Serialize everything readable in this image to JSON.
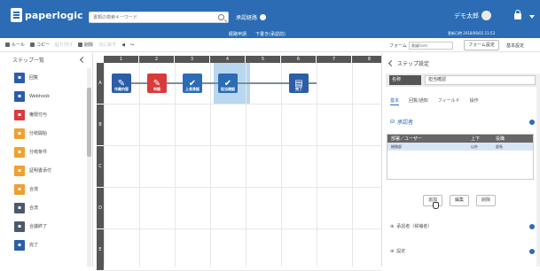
{
  "app": {
    "logo": "paperlogic"
  },
  "top": {
    "search_placeholder": "書類の検索キーワード",
    "workflow": "承認経路",
    "user": "デモ太郎"
  },
  "sub": {
    "center_a": "経路申請",
    "center_b": "下書き(承認前)",
    "right": "更新日時 2018/06/01 11:53"
  },
  "toolbar": {
    "items": [
      {
        "label": "ルール",
        "dim": false
      },
      {
        "label": "コピー",
        "dim": false
      },
      {
        "label": "貼り付け",
        "dim": true
      },
      {
        "label": "削除",
        "dim": false
      },
      {
        "label": "元に戻す",
        "dim": true
      }
    ],
    "form_label": "フォーム",
    "form_value": "稟議Form",
    "form_button": "フォーム設定",
    "basic_button": "基本設定"
  },
  "sidebar": {
    "title": "ステップ一覧",
    "items": [
      {
        "label": "回覧",
        "color": "blue"
      },
      {
        "label": "Webhook",
        "color": "blue"
      },
      {
        "label": "権限付与",
        "color": "red"
      },
      {
        "label": "分岐開始",
        "color": "orange"
      },
      {
        "label": "分岐条件",
        "color": "orange"
      },
      {
        "label": "証明書添付",
        "color": "orange"
      },
      {
        "label": "合流",
        "color": "orange"
      },
      {
        "label": "合流",
        "color": "dark"
      },
      {
        "label": "合議終了",
        "color": "dark"
      },
      {
        "label": "完了",
        "color": "blue"
      }
    ]
  },
  "grid": {
    "cols": [
      "1",
      "2",
      "3",
      "4",
      "5",
      "6",
      "7",
      "8"
    ],
    "rows": [
      "A",
      "B",
      "C",
      "D",
      "E"
    ],
    "nodes": [
      {
        "label": "作業内容",
        "color": "#2b5ea7",
        "icon": "edit"
      },
      {
        "label": "申請",
        "color": "#d93b3b",
        "icon": "edit"
      },
      {
        "label": "上長承認",
        "color": "#2b6cb5",
        "icon": "check"
      },
      {
        "label": "担当確認",
        "color": "#2b6cb5",
        "icon": "check"
      },
      {
        "label": "完了",
        "color": "#2b5ea7",
        "icon": "doc"
      }
    ]
  },
  "panel": {
    "title": "ステップ設定",
    "name_label": "名称",
    "name_value": "担当確認",
    "tabs": [
      "基本",
      "回覧/通知",
      "フィールド",
      "操作"
    ],
    "approver_section": "承認者",
    "table_headers": [
      "部署／ユーザー",
      "上下",
      "役職"
    ],
    "table_row": [
      "総務部",
      "以外",
      "部長"
    ],
    "buttons": [
      "追加",
      "編集",
      "削除"
    ],
    "section2": "承認者（候補者）",
    "section3": "設定"
  }
}
